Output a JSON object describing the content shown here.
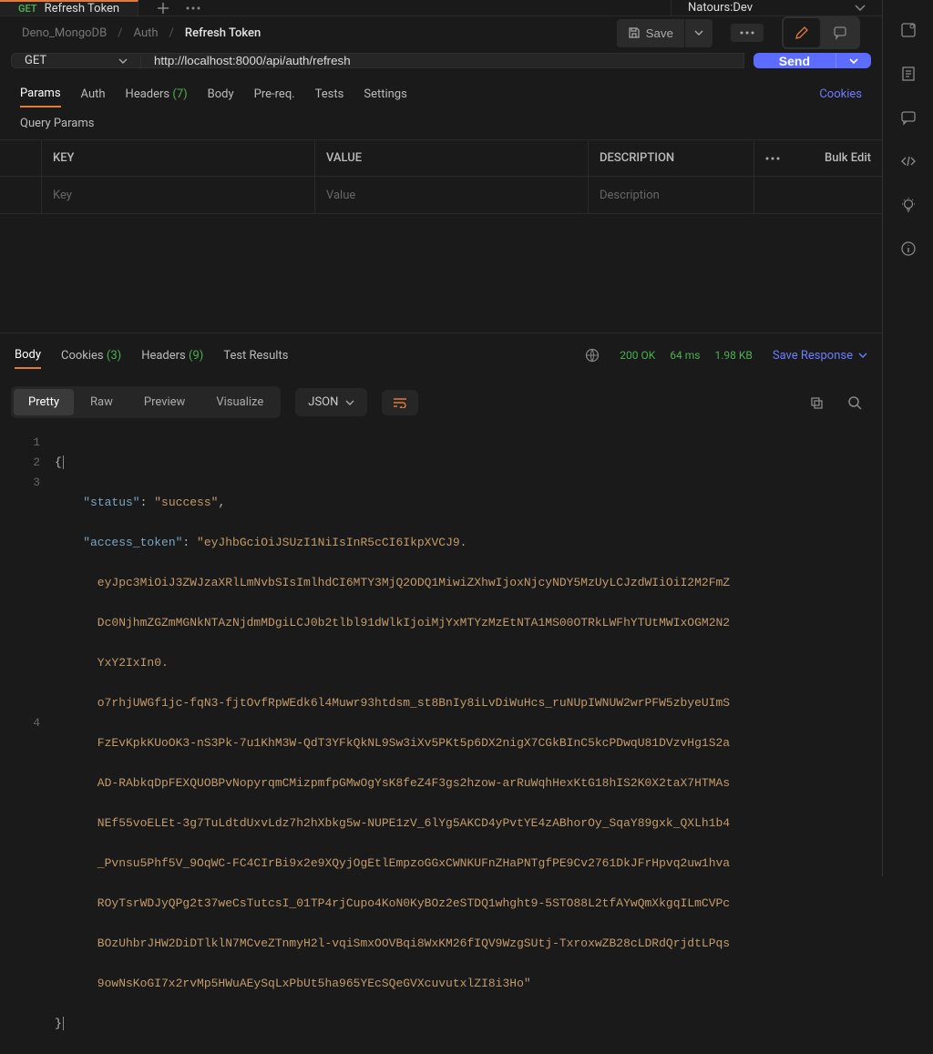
{
  "tab": {
    "method": "GET",
    "title": "Refresh Token"
  },
  "environment": "Natours:Dev",
  "breadcrumbs": {
    "root": "Deno_MongoDB",
    "mid": "Auth",
    "leaf": "Refresh Token"
  },
  "save_label": "Save",
  "request": {
    "method": "GET",
    "url": "http://localhost:8000/api/auth/refresh"
  },
  "send_label": "Send",
  "request_tabs": {
    "params": "Params",
    "auth": "Auth",
    "headers": "Headers",
    "headers_count": "(7)",
    "body": "Body",
    "prereq": "Pre-req.",
    "tests": "Tests",
    "settings": "Settings",
    "cookies": "Cookies"
  },
  "query_params_title": "Query Params",
  "qp_headers": {
    "key": "KEY",
    "value": "VALUE",
    "desc": "DESCRIPTION"
  },
  "qp_placeholders": {
    "key": "Key",
    "value": "Value",
    "desc": "Description"
  },
  "bulk_edit": "Bulk Edit",
  "response_tabs": {
    "body": "Body",
    "cookies": "Cookies",
    "cookies_count": "(3)",
    "headers": "Headers",
    "headers_count": "(9)",
    "test_results": "Test Results"
  },
  "status": {
    "code": "200",
    "text": "OK",
    "time": "64 ms",
    "size": "1.98 KB"
  },
  "save_response": "Save Response",
  "view": {
    "pretty": "Pretty",
    "raw": "Raw",
    "preview": "Preview",
    "visualize": "Visualize",
    "format": "JSON"
  },
  "json_body": {
    "line1_key": "\"status\"",
    "line1_val": "\"success\"",
    "line2_key": "\"access_token\"",
    "token_head": "\"eyJhbGciOiJSUzI1NiIsInR5cCI6IkpXVCJ9.",
    "token_l1": "eyJpc3MiOiJ3ZWJzaXRlLmNvbSIsImlhdCI6MTY3MjQ2ODQ1MiwiZXhwIjoxNjcyNDY5MzUyLCJzdWIiOiI2M2FmZ",
    "token_l2": "Dc0NjhmZGZmMGNkNTAzNjdmMDgiLCJ0b2tlbl91dWlkIjoiMjYxMTYzMzEtNTA1MS00OTRkLWFhYTUtMWIxOGM2N2",
    "token_l3": "YxY2IxIn0.",
    "token_l4": "o7rhjUWGf1jc-fqN3-fjtOvfRpWEdk6l4Muwr93htdsm_st8BnIy8iLvDiWuHcs_ruNUpIWNUW2wrPFW5zbyeUImS",
    "token_l5": "FzEvKpkKUoOK3-nS3Pk-7u1KhM3W-QdT3YFkQkNL9Sw3iXv5PKt5p6DX2nigX7CGkBInC5kcPDwqU81DVzvHg1S2a",
    "token_l6": "AD-RAbkqDpFEXQUOBPvNopyrqmCMizpmfpGMwOgYsK8feZ4F3gs2hzow-arRuWqhHexKtG18hIS2K0X2taX7HTMAs",
    "token_l7": "NEf55voELEt-3g7TuLdtdUxvLdz7h2hXbkg5w-NUPE1zV_6lYg5AKCD4yPvtYE4zABhorOy_SqaY89gxk_QXLh1b4",
    "token_l8": "_Pvnsu5Phf5V_9OqWC-FC4CIrBi9x2e9XQyjOgEtlEmpzoGGxCWNKUFnZHaPNTgfPE9Cv2761DkJFrHpvq2uw1hva",
    "token_l9": "ROyTsrWDJyQPg2t37weCsTutcsI_01TP4rjCupo4KoN0KyBOz2eSTDQ1whght9-5STO88L2tfAYwQmXkgqILmCVPc",
    "token_l10": "BOzUhbrJHW2DiDTlklN7MCveZTnmyH2l-vqiSmxOOVBqi8WxKM26fIQV9WzgSUtj-TxroxwZB28cLDRdQrjdtLPqs",
    "token_l11": "9owNsKoGI7x2rvMp5HWuAEySqLxPbUt5ha965YEcSQeGVXcuvutxlZI8i3Ho\""
  }
}
